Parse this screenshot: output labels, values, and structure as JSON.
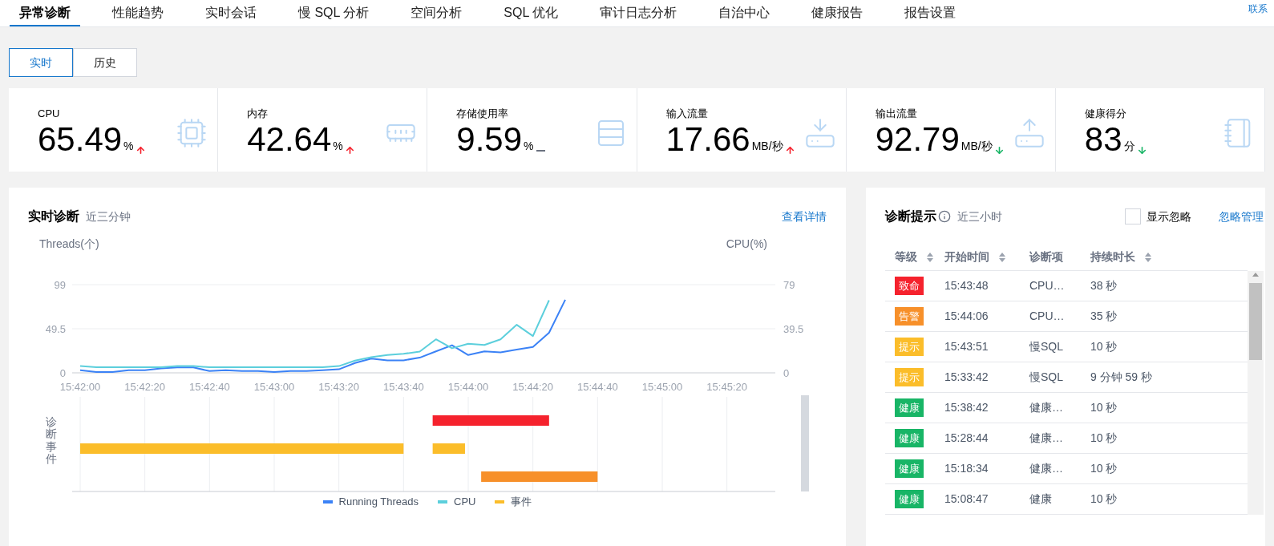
{
  "tabs": [
    {
      "label": "异常诊断",
      "selected": true
    },
    {
      "label": "性能趋势",
      "selected": false
    },
    {
      "label": "实时会话",
      "selected": false
    },
    {
      "label": "慢 SQL 分析",
      "selected": false
    },
    {
      "label": "空间分析",
      "selected": false
    },
    {
      "label": "SQL 优化",
      "selected": false
    },
    {
      "label": "审计日志分析",
      "selected": false
    },
    {
      "label": "自治中心",
      "selected": false
    },
    {
      "label": "健康报告",
      "selected": false
    },
    {
      "label": "报告设置",
      "selected": false
    }
  ],
  "contact_link": "联系",
  "modes": [
    {
      "label": "实时",
      "selected": true
    },
    {
      "label": "历史",
      "selected": false
    }
  ],
  "metrics": [
    {
      "label": "CPU",
      "value": "65.49",
      "unit": "%",
      "kind": "up"
    },
    {
      "label": "内存",
      "value": "42.64",
      "unit": "%",
      "kind": "up"
    },
    {
      "label": "存储使用率",
      "value": "9.59",
      "unit": "%",
      "kind": "flat"
    },
    {
      "label": "输入流量",
      "value": "17.66",
      "unit": "MB/秒",
      "kind": "up"
    },
    {
      "label": "输出流量",
      "value": "92.79",
      "unit": "MB/秒",
      "kind": "down"
    },
    {
      "label": "健康得分",
      "value": "83",
      "unit": "分",
      "kind": "down"
    }
  ],
  "realtime": {
    "title": "实时诊断",
    "subtitle": "近三分钟",
    "details_link": "查看详情",
    "events_axis_label": "诊断事件",
    "chart_data": {
      "type": "line",
      "legend": "bottom",
      "ylabel": "Threads(个)",
      "y2label": "CPU(%)",
      "categories": [
        "15:42:00",
        null,
        null,
        null,
        "15:42:20",
        null,
        null,
        null,
        "15:42:40",
        null,
        null,
        null,
        "15:43:00",
        null,
        null,
        null,
        "15:43:20",
        null,
        null,
        null,
        "15:43:40",
        null,
        null,
        null,
        "15:44:00",
        null,
        null,
        null,
        "15:44:20",
        null,
        null,
        null,
        "15:44:40",
        null,
        null,
        null,
        "15:45:00",
        null,
        null,
        null,
        "15:45:20",
        null,
        null
      ],
      "ylim": [
        0,
        99
      ],
      "yticks": [
        {
          "value": 0,
          "label": "0"
        },
        {
          "value": 49.5,
          "label": "49.5"
        },
        {
          "value": 99,
          "label": "99"
        }
      ],
      "y2lim": [
        0,
        79
      ],
      "y2ticks": [
        {
          "value": 0,
          "label": "0"
        },
        {
          "value": 39.5,
          "label": "39.5"
        },
        {
          "value": 79,
          "label": "79"
        }
      ],
      "series": [
        {
          "name": "Running Threads",
          "color": "#3b82f6",
          "values": [
            3,
            1,
            1,
            3,
            3,
            5,
            6,
            6,
            2,
            3,
            2,
            2,
            1,
            2,
            2,
            3,
            4,
            11,
            16,
            14,
            14,
            17,
            24,
            31,
            20,
            24,
            23,
            26,
            29,
            45,
            82,
            null,
            null,
            null,
            null,
            null,
            null,
            null,
            null,
            null,
            null,
            null,
            null
          ]
        },
        {
          "name": "CPU",
          "color": "#5ccfdc",
          "axis": "y2",
          "values": [
            6,
            5,
            5,
            5,
            5,
            5,
            6,
            6,
            5,
            5,
            5,
            5,
            5,
            5,
            5,
            5,
            6,
            11,
            14,
            16,
            17,
            19,
            30,
            22,
            26,
            25,
            30,
            43,
            33,
            65,
            null,
            null,
            null,
            null,
            null,
            null,
            null,
            null,
            null,
            null,
            null,
            null,
            null
          ]
        }
      ]
    },
    "event_legend": {
      "name": "事件",
      "color": "#fbbd2a"
    },
    "events": [
      {
        "color": "#f5222d"
      },
      {
        "color": "#fbbd2a"
      },
      {
        "color": "#fbbd2a"
      },
      {
        "color": "#f7902a"
      }
    ]
  },
  "hints": {
    "title": "诊断提示",
    "subtitle": "近三小时",
    "show_ignored": {
      "label": "显示忽略",
      "checked": false
    },
    "manage_link": "忽略管理",
    "columns": [
      {
        "label": "等级",
        "sortable": true
      },
      {
        "label": "开始时间",
        "sortable": true
      },
      {
        "label": "诊断项",
        "sortable": false
      },
      {
        "label": "持续时长",
        "sortable": true
      }
    ],
    "rows": [
      {
        "level": "致命",
        "color": "#f5222d",
        "start": "15:43:48",
        "item": "CPU…",
        "duration": "38 秒"
      },
      {
        "level": "告警",
        "color": "#f7902a",
        "start": "15:44:06",
        "item": "CPU…",
        "duration": "35 秒"
      },
      {
        "level": "提示",
        "color": "#fbbd2a",
        "start": "15:43:51",
        "item": "慢SQL",
        "duration": "10 秒"
      },
      {
        "level": "提示",
        "color": "#fbbd2a",
        "start": "15:33:42",
        "item": "慢SQL",
        "duration": "9 分钟 59 秒"
      },
      {
        "level": "健康",
        "color": "#18b566",
        "start": "15:38:42",
        "item": "健康…",
        "duration": "10 秒"
      },
      {
        "level": "健康",
        "color": "#18b566",
        "start": "15:28:44",
        "item": "健康…",
        "duration": "10 秒"
      },
      {
        "level": "健康",
        "color": "#18b566",
        "start": "15:18:34",
        "item": "健康…",
        "duration": "10 秒"
      },
      {
        "level": "健康",
        "color": "#18b566",
        "start": "15:08:47",
        "item": "健康",
        "duration": "10 秒"
      }
    ]
  }
}
